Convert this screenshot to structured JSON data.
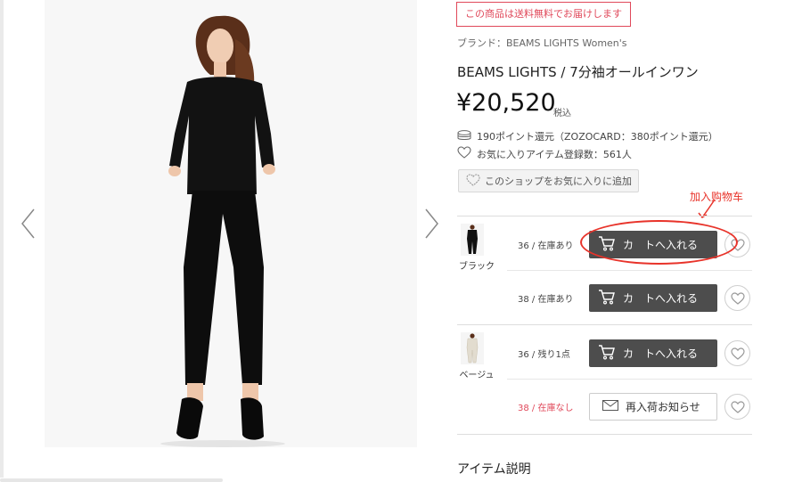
{
  "gallery": {
    "prev_icon": "chevron-left-icon",
    "next_icon": "chevron-right-icon",
    "image_subject": "model wearing black 7-sleeve all-in-one jumpsuit"
  },
  "product": {
    "shipping_notice": "この商品は送料無料でお届けします",
    "brand_line": "ブランド：BEAMS LIGHTS Women's",
    "title": "BEAMS LIGHTS / 7分袖オールインワン",
    "price": "¥20,520",
    "tax_label": "税込",
    "points_text": "190ポイント還元（ZOZOCARD：380ポイント還元）",
    "favorites_text": "お気に入りアイテム登録数：561人",
    "shop_favorite_label": "このショップをお気に入りに追加"
  },
  "annotation": {
    "text": "加入购物车",
    "color": "#e8332a"
  },
  "skus": [
    {
      "color": "ブラック",
      "size_stock": "36 / 在庫あり",
      "button": "カ　トへ入れる",
      "button_type": "cart"
    },
    {
      "color": "",
      "size_stock": "38 / 在庫あり",
      "button": "カ　トへ入れる",
      "button_type": "cart"
    },
    {
      "color": "ベージュ",
      "size_stock": "36 / 残り1点",
      "button": "カ　トへ入れる",
      "button_type": "cart"
    },
    {
      "color": "",
      "size_stock": "38 / 在庫なし",
      "button": "再入荷お知らせ",
      "button_type": "notify"
    }
  ],
  "section": {
    "item_description_heading": "アイテム説明"
  },
  "colors": {
    "accent_red": "#e0485a",
    "cart_button": "#4d4d4d"
  }
}
